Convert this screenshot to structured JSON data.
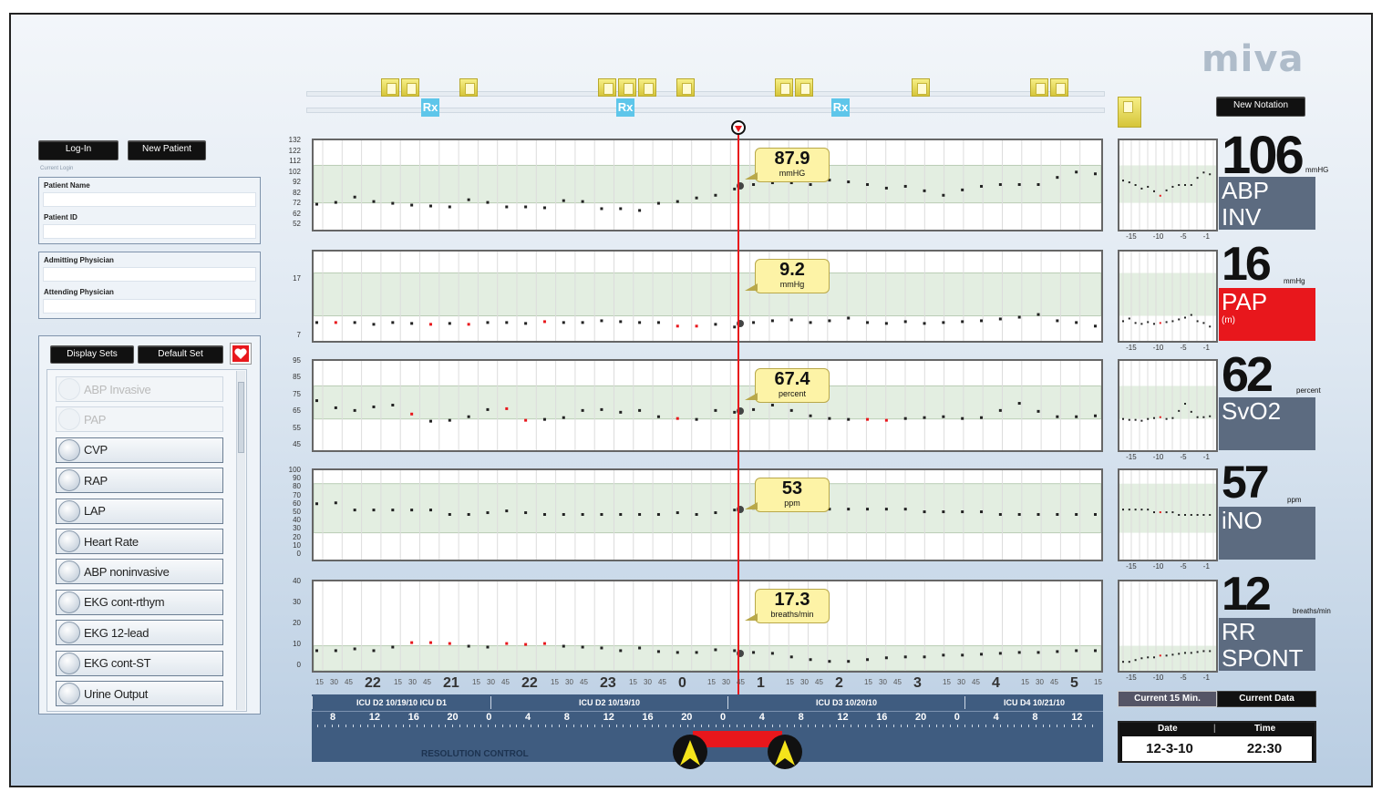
{
  "logo": "miva",
  "actions": {
    "login": "Log-In",
    "new_patient": "New Patient",
    "new_notation": "New Notation"
  },
  "current_login_label": "Current Login",
  "patient": {
    "name_label": "Patient Name",
    "id_label": "Patient ID"
  },
  "physician": {
    "admitting_label": "Admitting Physician",
    "attending_label": "Attending Physician"
  },
  "display_sets": {
    "display_sets_label": "Display Sets",
    "default_set_label": "Default Set",
    "items": [
      {
        "label": "ABP Invasive",
        "dim": true
      },
      {
        "label": "PAP",
        "dim": true
      },
      {
        "label": "CVP",
        "dim": false
      },
      {
        "label": "RAP",
        "dim": false
      },
      {
        "label": "LAP",
        "dim": false
      },
      {
        "label": "Heart Rate",
        "dim": false
      },
      {
        "label": "ABP noninvasive",
        "dim": false
      },
      {
        "label": "EKG cont-rthym",
        "dim": false
      },
      {
        "label": "EKG 12-lead",
        "dim": false
      },
      {
        "label": "EKG cont-ST",
        "dim": false
      },
      {
        "label": "Urine Output",
        "dim": false
      }
    ]
  },
  "notation_marker_rx": "Rx",
  "charts": [
    {
      "callout_value": "87.9",
      "callout_unit": "mmHG",
      "yticks": [
        "132",
        "122",
        "112",
        "102",
        "92",
        "82",
        "72",
        "62",
        "52"
      ],
      "band": [
        0.3,
        0.72
      ],
      "values": [
        0.28,
        0.3,
        0.36,
        0.31,
        0.29,
        0.27,
        0.26,
        0.25,
        0.33,
        0.3,
        0.25,
        0.25,
        0.24,
        0.32,
        0.31,
        0.23,
        0.23,
        0.21,
        0.29,
        0.31,
        0.35,
        0.38,
        0.45,
        0.5,
        0.52,
        0.52,
        0.5,
        0.55,
        0.53,
        0.5,
        0.46,
        0.48,
        0.43,
        0.38,
        0.44,
        0.48,
        0.5,
        0.5,
        0.5,
        0.58,
        0.64,
        0.62
      ]
    },
    {
      "callout_value": "9.2",
      "callout_unit": "mmHg",
      "yticks": [
        "17",
        "7"
      ],
      "band": [
        0.28,
        0.76
      ],
      "values": [
        0.2,
        0.2,
        0.2,
        0.18,
        0.2,
        0.19,
        0.18,
        0.19,
        0.18,
        0.2,
        0.2,
        0.19,
        0.21,
        0.2,
        0.2,
        0.22,
        0.21,
        0.2,
        0.2,
        0.16,
        0.16,
        0.18,
        0.15,
        0.2,
        0.22,
        0.23,
        0.2,
        0.22,
        0.25,
        0.2,
        0.19,
        0.21,
        0.19,
        0.2,
        0.21,
        0.22,
        0.24,
        0.26,
        0.29,
        0.22,
        0.2,
        0.16
      ],
      "red": [
        1,
        6,
        8,
        12,
        19,
        20
      ]
    },
    {
      "callout_value": "67.4",
      "callout_unit": "percent",
      "yticks": [
        "95",
        "85",
        "75",
        "65",
        "55",
        "45"
      ],
      "band": [
        0.35,
        0.72
      ],
      "values": [
        0.55,
        0.47,
        0.44,
        0.48,
        0.5,
        0.4,
        0.32,
        0.33,
        0.37,
        0.45,
        0.46,
        0.33,
        0.34,
        0.36,
        0.44,
        0.45,
        0.42,
        0.44,
        0.37,
        0.35,
        0.34,
        0.44,
        0.42,
        0.45,
        0.5,
        0.44,
        0.38,
        0.35,
        0.34,
        0.34,
        0.33,
        0.35,
        0.36,
        0.37,
        0.35,
        0.36,
        0.44,
        0.52,
        0.43,
        0.37,
        0.37,
        0.38
      ],
      "red": [
        5,
        10,
        11,
        19,
        29,
        30
      ]
    },
    {
      "callout_value": "53",
      "callout_unit": "ppm",
      "yticks": [
        "100",
        "90",
        "80",
        "70",
        "60",
        "50",
        "40",
        "30",
        "20",
        "10",
        "0"
      ],
      "band": [
        0.3,
        0.85
      ],
      "values": [
        0.62,
        0.63,
        0.55,
        0.55,
        0.55,
        0.55,
        0.55,
        0.5,
        0.5,
        0.52,
        0.54,
        0.52,
        0.5,
        0.5,
        0.5,
        0.5,
        0.5,
        0.5,
        0.5,
        0.52,
        0.5,
        0.52,
        0.55,
        0.57,
        0.55,
        0.56,
        0.57,
        0.56,
        0.56,
        0.56,
        0.56,
        0.56,
        0.53,
        0.53,
        0.53,
        0.53,
        0.5,
        0.5,
        0.5,
        0.5,
        0.5,
        0.5
      ]
    },
    {
      "callout_value": "17.3",
      "callout_unit": "breaths/min",
      "yticks": [
        "40",
        "30",
        "20",
        "10",
        "0"
      ],
      "band": [
        0.0,
        0.28
      ],
      "values": [
        0.22,
        0.22,
        0.24,
        0.22,
        0.26,
        0.31,
        0.31,
        0.3,
        0.27,
        0.26,
        0.3,
        0.29,
        0.3,
        0.27,
        0.26,
        0.25,
        0.22,
        0.25,
        0.21,
        0.2,
        0.2,
        0.23,
        0.22,
        0.2,
        0.19,
        0.15,
        0.12,
        0.1,
        0.1,
        0.12,
        0.14,
        0.15,
        0.15,
        0.17,
        0.17,
        0.18,
        0.19,
        0.2,
        0.2,
        0.21,
        0.22,
        0.22
      ],
      "red": [
        5,
        6,
        7,
        10,
        11,
        12
      ]
    }
  ],
  "vitals": [
    {
      "value": "106",
      "unit": "mmHG",
      "name_line1": "ABP",
      "name_line2": "INV",
      "alarm": false
    },
    {
      "value": "16",
      "unit": "mmHg",
      "name_line1": "PAP",
      "name_line2": "(m)",
      "alarm": true
    },
    {
      "value": "62",
      "unit": "percent",
      "name_line1": "SvO2",
      "name_line2": "",
      "alarm": false
    },
    {
      "value": "57",
      "unit": "ppm",
      "name_line1": "iNO",
      "name_line2": "",
      "alarm": false
    },
    {
      "value": "12",
      "unit": "breaths/min",
      "name_line1": "RR",
      "name_line2": "SPONT",
      "alarm": false
    }
  ],
  "mini_axis": [
    "-15",
    "-10",
    "-5",
    "-1"
  ],
  "time_axis": {
    "minor": [
      "15",
      "30",
      "45"
    ],
    "hours": [
      "22",
      "21",
      "22",
      "23",
      "0",
      "1",
      "2",
      "3",
      "4",
      "5"
    ],
    "last_minor": "15"
  },
  "timeline": {
    "segments": [
      {
        "label": "ICU D2  10/19/10  ICU D1"
      },
      {
        "label": "ICU D2  10/19/10"
      },
      {
        "label": "ICU D3  10/20/10"
      },
      {
        "label": "ICU D4  10/21/10"
      }
    ],
    "hour_labels": [
      "8",
      "12",
      "16",
      "20",
      "0",
      "4",
      "8",
      "12",
      "16",
      "20",
      "0",
      "4",
      "8",
      "12",
      "16",
      "20",
      "0",
      "4",
      "8",
      "12"
    ],
    "resolution_label": "RESOLUTION CONTROL"
  },
  "tabs": {
    "current_15": "Current 15 Min.",
    "current_data": "Current Data"
  },
  "datetime": {
    "date_label": "Date",
    "time_label": "Time",
    "date": "12-3-10",
    "time": "22:30"
  },
  "colors": {
    "alarm_red": "#e8171c",
    "band_green": "#e3eee1",
    "timeline_blue": "#3f5c80",
    "callout_yellow": "#fdf3a6"
  }
}
